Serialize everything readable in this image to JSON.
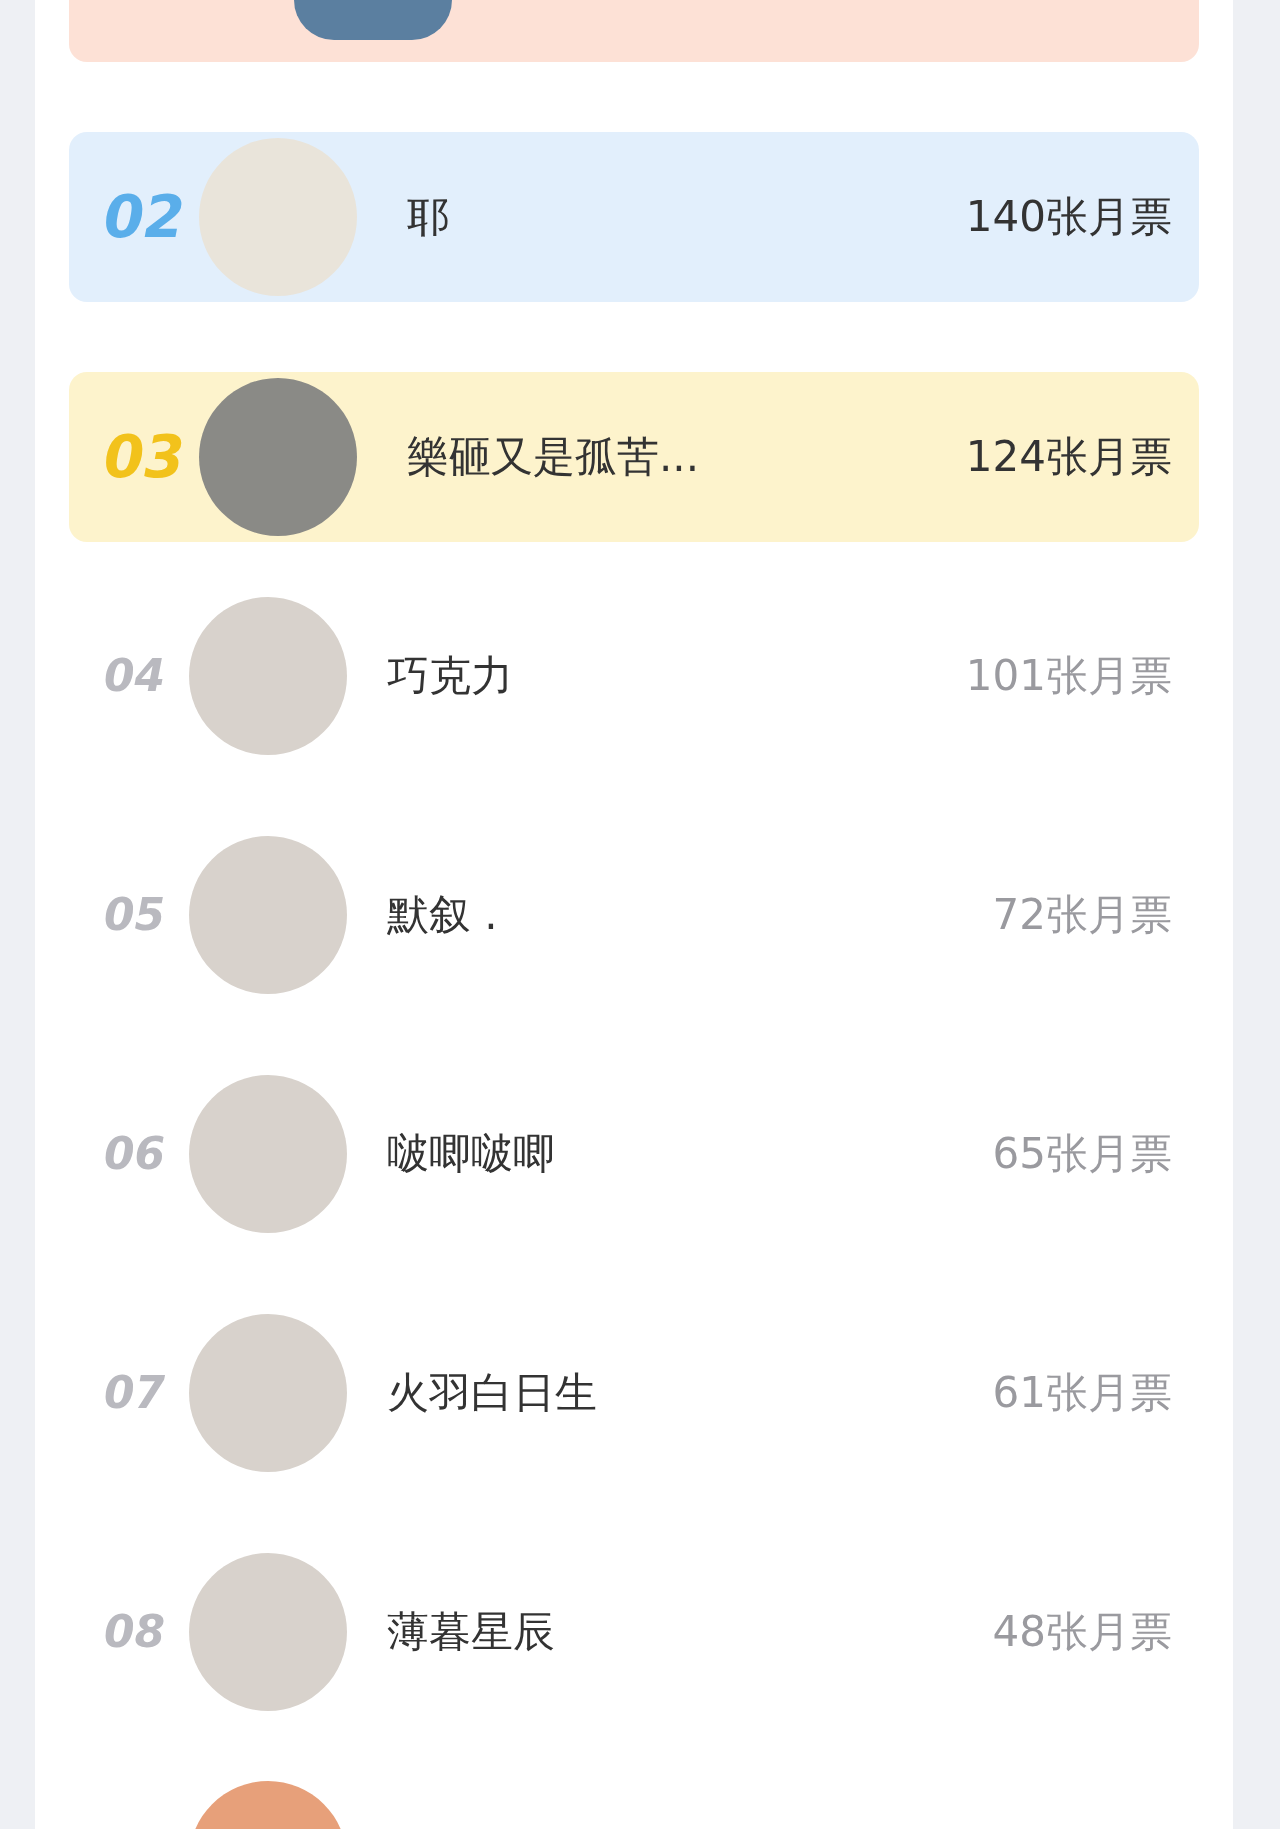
{
  "top_row": {
    "kind": "first"
  },
  "rows": [
    {
      "rank": "02",
      "name": "耶",
      "count": "140张月票",
      "kind": "second"
    },
    {
      "rank": "03",
      "name": "樂砸又是孤苦...",
      "count": "124张月票",
      "kind": "third"
    },
    {
      "rank": "04",
      "name": "巧克力",
      "count": "101张月票",
      "kind": "plain"
    },
    {
      "rank": "05",
      "name": "默叙 .",
      "count": "72张月票",
      "kind": "plain"
    },
    {
      "rank": "06",
      "name": "啵唧啵唧",
      "count": "65张月票",
      "kind": "plain"
    },
    {
      "rank": "07",
      "name": "火羽白日生",
      "count": "61张月票",
      "kind": "plain"
    },
    {
      "rank": "08",
      "name": "薄暮星辰",
      "count": "48张月票",
      "kind": "plain"
    }
  ]
}
